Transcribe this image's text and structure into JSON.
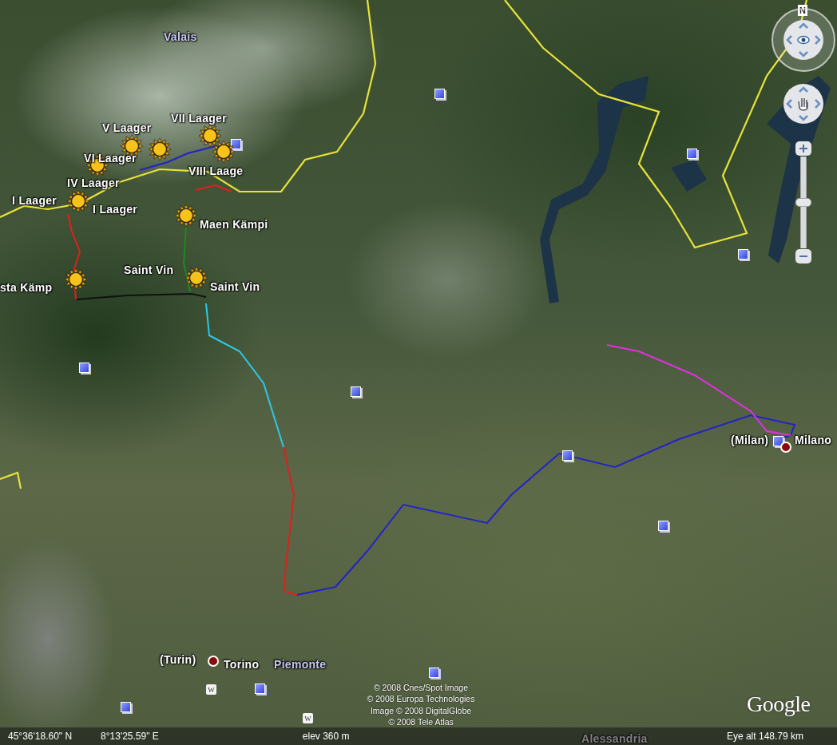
{
  "map": {
    "labels": [
      {
        "kind": "region",
        "text": "Valais"
      },
      {
        "kind": "place",
        "text": "VII Laager"
      },
      {
        "kind": "place",
        "text": "V Laager"
      },
      {
        "kind": "place",
        "text": "VI Laager"
      },
      {
        "kind": "place",
        "text": "IV Laager"
      },
      {
        "kind": "place",
        "text": "I Laager"
      },
      {
        "kind": "place",
        "text": "I Laager"
      },
      {
        "kind": "place",
        "text": "VIII Laage"
      },
      {
        "kind": "place",
        "text": "Maen Kämpi"
      },
      {
        "kind": "place",
        "text": "Saint Vin"
      },
      {
        "kind": "place",
        "text": "sta Kämp"
      },
      {
        "kind": "place",
        "text": "Saint Vin"
      },
      {
        "kind": "place",
        "text": "(Milan)"
      },
      {
        "kind": "place",
        "text": "Milano"
      },
      {
        "kind": "place",
        "text": "(Turin)"
      },
      {
        "kind": "place",
        "text": "Torino"
      },
      {
        "kind": "region",
        "text": "Piemonte"
      },
      {
        "kind": "place",
        "text": "Alessandria"
      }
    ],
    "wiki_markers": [
      {
        "glyph": "W"
      },
      {
        "glyph": "W"
      }
    ],
    "copyright": [
      "© 2008 Cnes/Spot Image",
      "© 2008 Europa Technologies",
      "Image © 2008 DigitalGlobe",
      "© 2008 Tele Atlas"
    ],
    "logo": "Google"
  },
  "controls": {
    "compass": "N",
    "zoom": {
      "level": 0.5
    }
  },
  "status_bar": {
    "latitude": "45°36'18.60\" N",
    "longitude": "8°13'25.59\" E",
    "elevation": "elev  360 m",
    "eye_altitude": "Eye alt   148.79 km"
  }
}
